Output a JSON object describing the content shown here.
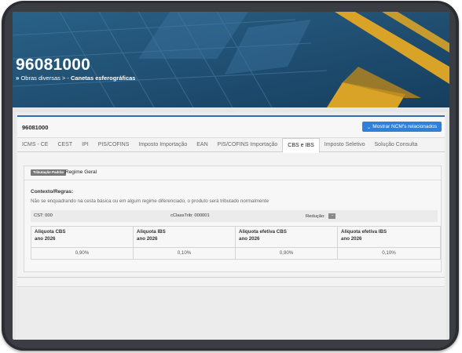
{
  "hero": {
    "title": "96081000",
    "breadcrumb_prefix": "Obras diversas > - ",
    "breadcrumb_current": "Canetas esferográficas",
    "colors": {
      "background": "#1d4b6e",
      "accent_gold": "#d8a327"
    }
  },
  "card": {
    "ncm_code": "96081000",
    "related_button_label": "Mostrar NCM's relacionados",
    "related_button_icon": "chevron-down-icon",
    "accent_color": "#2f80d8"
  },
  "tabs": [
    {
      "label": "ICMS - CE",
      "active": false
    },
    {
      "label": "CEST",
      "active": false
    },
    {
      "label": "IPI",
      "active": false
    },
    {
      "label": "PIS/COFINS",
      "active": false
    },
    {
      "label": "Imposto Importação",
      "active": false
    },
    {
      "label": "EAN",
      "active": false
    },
    {
      "label": "PIS/COFINS Importação",
      "active": false
    },
    {
      "label": "CBS e IBS",
      "active": true
    },
    {
      "label": "Imposto Seletivo",
      "active": false
    },
    {
      "label": "Solução Consulta",
      "active": false
    }
  ],
  "panel": {
    "badge": "Tributação Padrão",
    "regime": "Regime Geral",
    "context_label": "Contexto/Regras:",
    "context_text": "Não se enquadrando na cesta básica ou em algum regime diferenciado, o produto será tributado normalmente",
    "cst": "CST: 000",
    "cclass": "cClassTrib: 000001",
    "reducao_label": "Redução:",
    "reducao_value": "–"
  },
  "rates": {
    "headers": [
      {
        "line1": "Aliquota CBS",
        "line2": "ano 2026"
      },
      {
        "line1": "Aliquota IBS",
        "line2": "ano 2026"
      },
      {
        "line1": "Aliquota efetiva CBS",
        "line2": "ano 2026"
      },
      {
        "line1": "Aliquota efetiva IBS",
        "line2": "ano 2026"
      }
    ],
    "values": [
      "0,90%",
      "0,10%",
      "0,90%",
      "0,10%"
    ]
  }
}
